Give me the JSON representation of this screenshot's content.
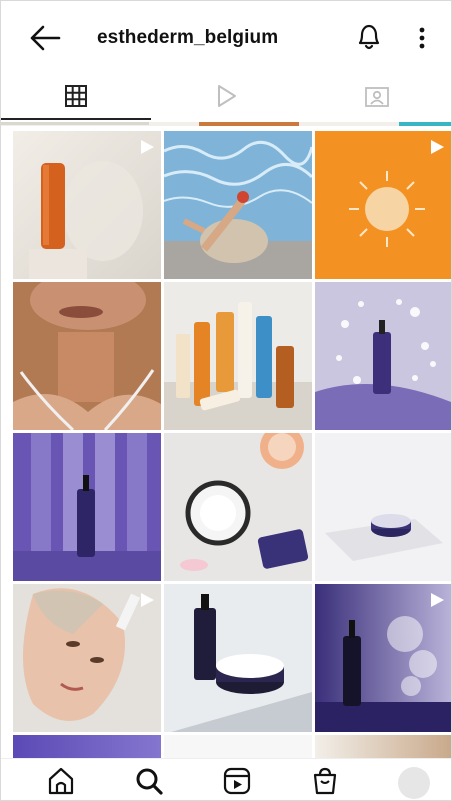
{
  "header": {
    "username": "esthederm_belgium",
    "icons": {
      "back": "back-arrow-icon",
      "notifications": "bell-icon",
      "more": "more-options-icon"
    }
  },
  "tabs": [
    {
      "icon": "grid-icon",
      "selected": true
    },
    {
      "icon": "reels-play-icon",
      "selected": false
    },
    {
      "icon": "tagged-photos-icon",
      "selected": false
    }
  ],
  "grid": {
    "posts": [
      {
        "subject": "orange sunscreen tube on white stand",
        "reel": true
      },
      {
        "subject": "person sunbathing on pool tiles",
        "reel": false
      },
      {
        "subject": "sun illustration on orange background",
        "reel": true
      },
      {
        "subject": "close-up of woman's neck and chin",
        "reel": false
      },
      {
        "subject": "group of sun care products",
        "reel": false
      },
      {
        "subject": "purple serum bottle with drops",
        "reel": false
      },
      {
        "subject": "serum bottle on purple striped background",
        "reel": false
      },
      {
        "subject": "open cream jar with grapefruit",
        "reel": false
      },
      {
        "subject": "cream jar on white marble block",
        "reel": false
      },
      {
        "subject": "woman applying serum to face",
        "reel": true
      },
      {
        "subject": "serum bottle and cream jar",
        "reel": false
      },
      {
        "subject": "serum bottle with purple mist",
        "reel": true
      }
    ]
  },
  "bottom_nav": {
    "items": [
      "home-icon",
      "search-icon",
      "reels-icon",
      "shop-icon"
    ],
    "profile": "profile-avatar"
  },
  "colors": {
    "orange": "#f39223",
    "purple": "#6a5bb0",
    "text": "#111111",
    "tab_active": "#222222",
    "tab_inactive": "#bfbfbf"
  }
}
